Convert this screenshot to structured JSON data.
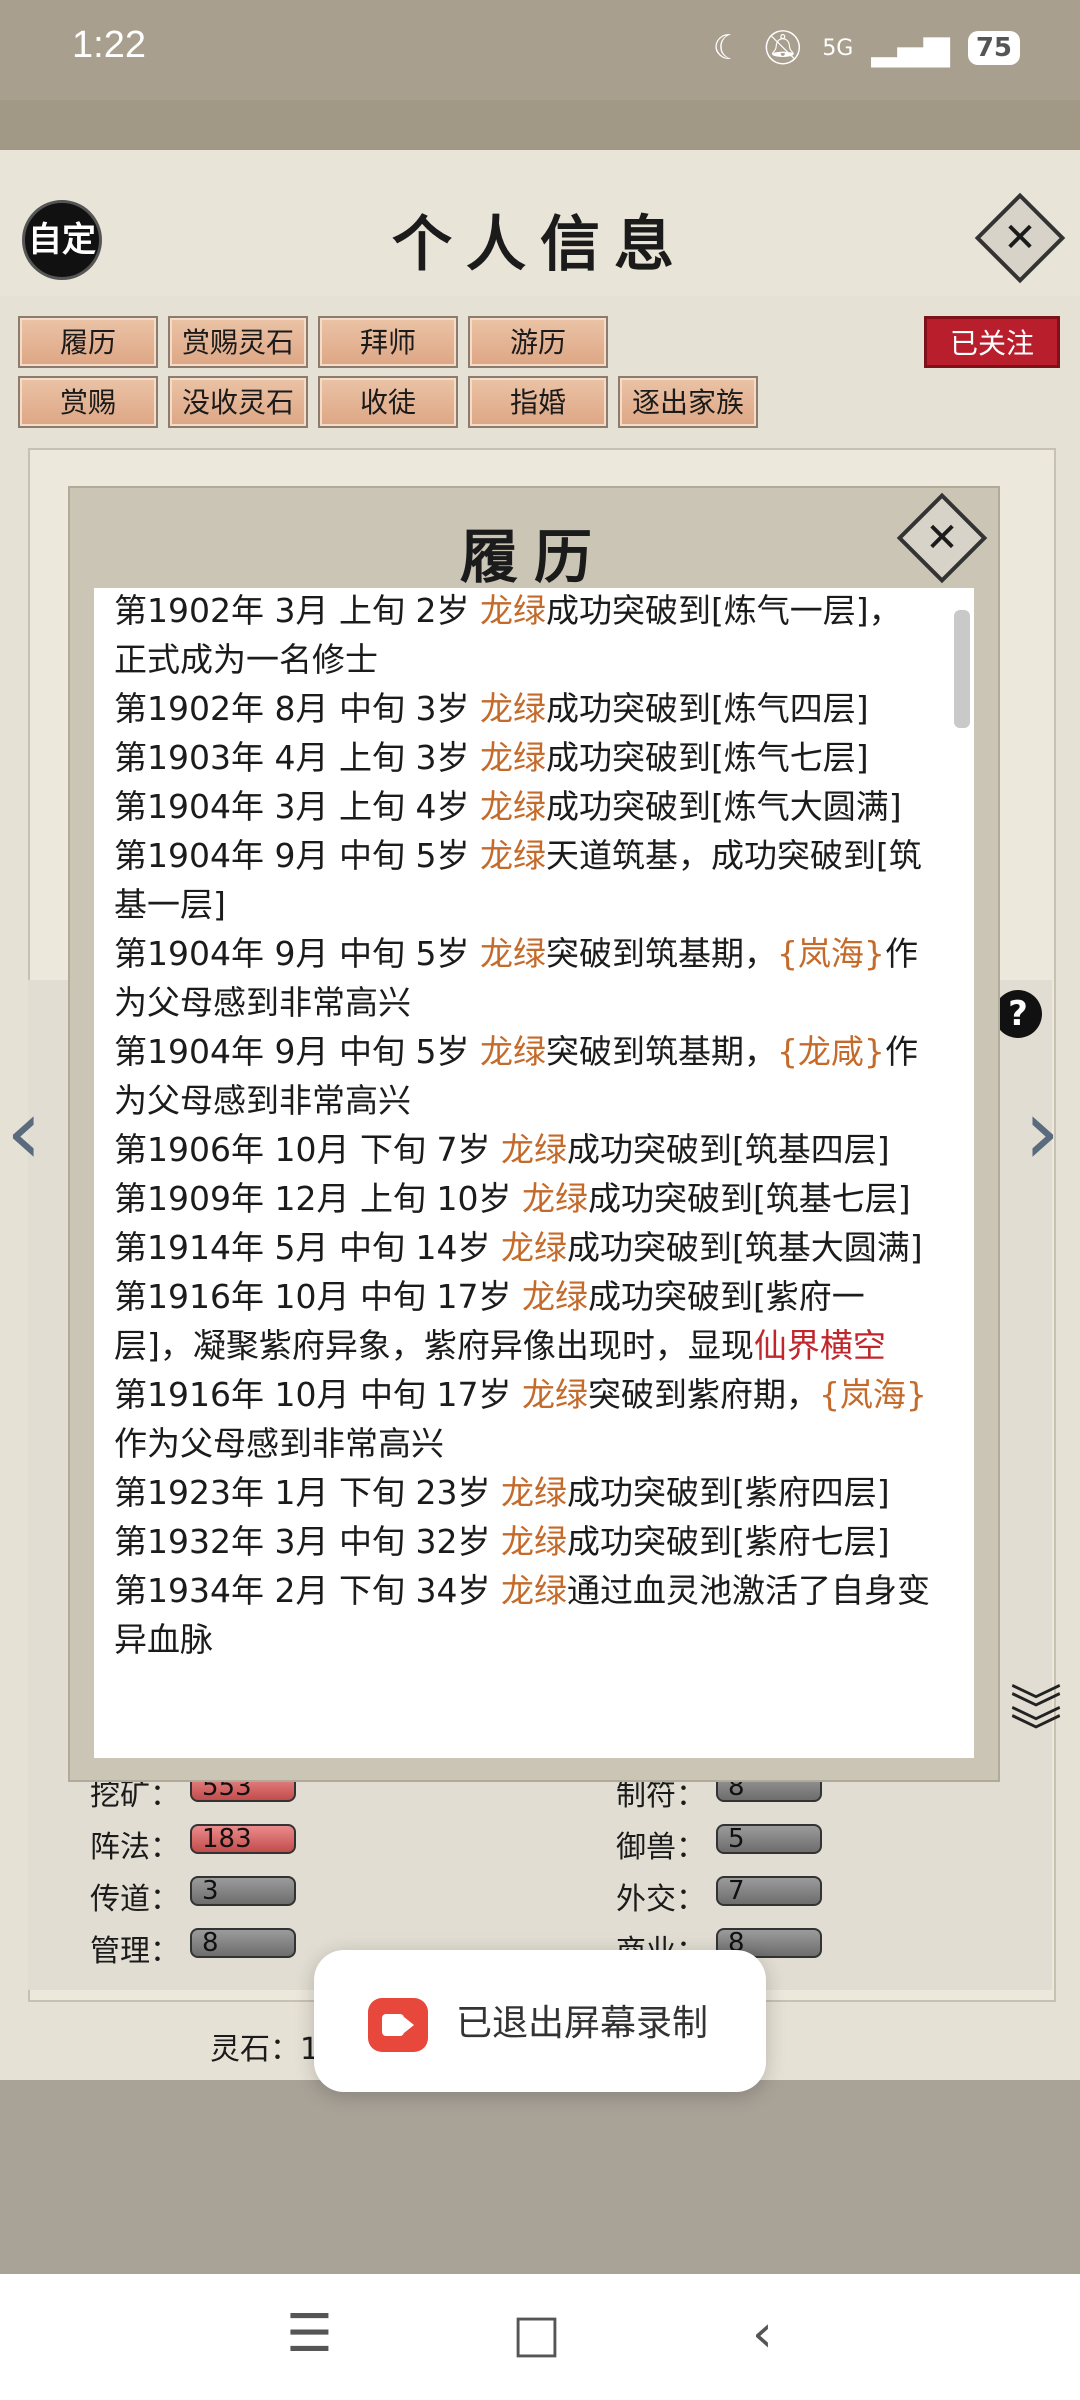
{
  "status_bar": {
    "time": "1:22",
    "signal": "5G",
    "battery": "75"
  },
  "header": {
    "title": "个人信息",
    "custom_label": "自定",
    "close_glyph": "✕"
  },
  "tabs_row1": [
    "履历",
    "赏赐灵石",
    "拜师",
    "游历"
  ],
  "tabs_row2": [
    "赏赐",
    "没收灵石",
    "收徒",
    "指婚",
    "逐出家族"
  ],
  "followed_label": "已关注",
  "stats": [
    {
      "label": "挖矿：",
      "value": "553",
      "style": "red"
    },
    {
      "label": "制符：",
      "value": "8",
      "style": "gray"
    },
    {
      "label": "阵法：",
      "value": "183",
      "style": "red"
    },
    {
      "label": "御兽：",
      "value": "5",
      "style": "gray"
    },
    {
      "label": "传道：",
      "value": "3",
      "style": "gray"
    },
    {
      "label": "外交：",
      "value": "7",
      "style": "gray"
    },
    {
      "label": "管理：",
      "value": "8",
      "style": "gray"
    },
    {
      "label": "商业：",
      "value": "8",
      "style": "gray"
    }
  ],
  "lingshi_label": "灵石：1",
  "dialog": {
    "title": "履历",
    "close_glyph": "✕"
  },
  "log": [
    [
      {
        "t": "第1902年 3月 上旬  2岁  "
      },
      {
        "t": "龙绿",
        "c": "n"
      },
      {
        "t": "成功突破到[炼气一层]，正式成为一名修士"
      }
    ],
    [
      {
        "t": "第1902年 8月 中旬  3岁  "
      },
      {
        "t": "龙绿",
        "c": "n"
      },
      {
        "t": "成功突破到[炼气四层]"
      }
    ],
    [
      {
        "t": "第1903年 4月 上旬  3岁  "
      },
      {
        "t": "龙绿",
        "c": "n"
      },
      {
        "t": "成功突破到[炼气七层]"
      }
    ],
    [
      {
        "t": "第1904年 3月 上旬  4岁  "
      },
      {
        "t": "龙绿",
        "c": "n"
      },
      {
        "t": "成功突破到[炼气大圆满]"
      }
    ],
    [
      {
        "t": "第1904年 9月 中旬 5岁 "
      },
      {
        "t": "龙绿",
        "c": "n"
      },
      {
        "t": "天道筑基，成功突破到[筑基一层]"
      }
    ],
    [
      {
        "t": "第1904年 9月 中旬  5岁  "
      },
      {
        "t": "龙绿",
        "c": "n"
      },
      {
        "t": "突破到筑基期，"
      },
      {
        "t": "{岚海}",
        "c": "n"
      },
      {
        "t": "作为父母感到非常高兴"
      }
    ],
    [
      {
        "t": "第1904年 9月 中旬  5岁  "
      },
      {
        "t": "龙绿",
        "c": "n"
      },
      {
        "t": "突破到筑基期，"
      },
      {
        "t": "{龙咸}",
        "c": "n"
      },
      {
        "t": "作为父母感到非常高兴"
      }
    ],
    [
      {
        "t": "第1906年 10月 下旬  7岁  "
      },
      {
        "t": "龙绿",
        "c": "n"
      },
      {
        "t": "成功突破到[筑基四层]"
      }
    ],
    [
      {
        "t": "第1909年 12月 上旬  10岁  "
      },
      {
        "t": "龙绿",
        "c": "n"
      },
      {
        "t": "成功突破到[筑基七层]"
      }
    ],
    [
      {
        "t": "第1914年 5月 中旬 14岁 "
      },
      {
        "t": "龙绿",
        "c": "n"
      },
      {
        "t": "成功突破到[筑基大圆满]"
      }
    ],
    [
      {
        "t": "第1916年  10月  中旬   17岁   "
      },
      {
        "t": "龙绿",
        "c": "n"
      },
      {
        "t": "成功突破到[紫府一层]，凝聚紫府异象，紫府异像出现时，显现"
      },
      {
        "t": "仙界横空",
        "c": "r"
      }
    ],
    [
      {
        "t": "第1916年  10月  中旬   17岁   "
      },
      {
        "t": "龙绿",
        "c": "n"
      },
      {
        "t": "突破到紫府期，"
      },
      {
        "t": "{岚海}",
        "c": "n"
      },
      {
        "t": "作为父母感到非常高兴"
      }
    ],
    [
      {
        "t": "第1923年 1月 下旬  23岁  "
      },
      {
        "t": "龙绿",
        "c": "n"
      },
      {
        "t": "成功突破到[紫府四层]"
      }
    ],
    [
      {
        "t": "第1932年 3月 中旬  32岁  "
      },
      {
        "t": "龙绿",
        "c": "n"
      },
      {
        "t": "成功突破到[紫府七层]"
      }
    ],
    [
      {
        "t": "第1934年 2月 下旬  34岁  "
      },
      {
        "t": "龙绿",
        "c": "n"
      },
      {
        "t": "通过血灵池激活了自身变异血脉"
      }
    ]
  ],
  "toast": {
    "text": "已退出屏幕录制"
  },
  "colors": {
    "name": "#c46a2a",
    "highlight": "#c0272d",
    "followed": "#b81e2b"
  }
}
